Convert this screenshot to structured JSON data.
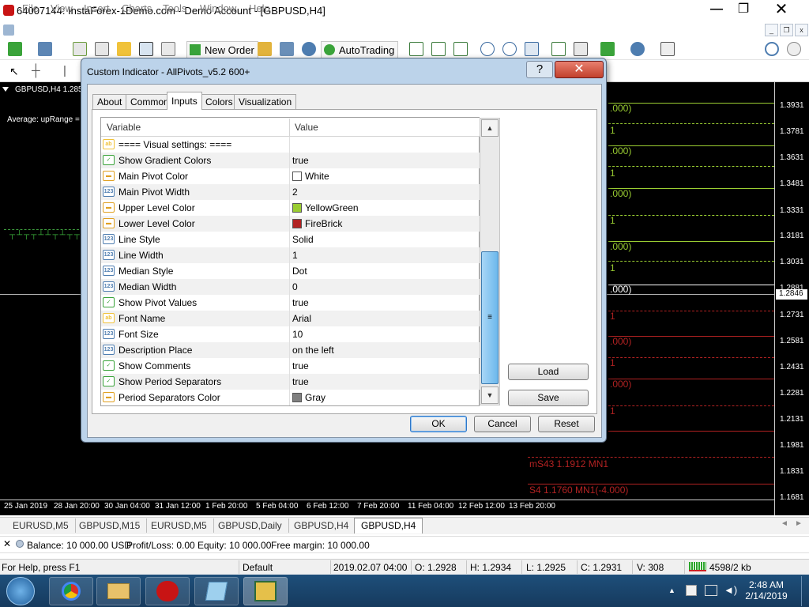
{
  "app": {
    "title": "64007144: InstaForex-1Demo.com - Demo Account - [GBPUSD,H4]",
    "window_controls": [
      "—",
      "❐",
      "✕"
    ]
  },
  "menu": [
    "File",
    "View",
    "Insert",
    "Charts",
    "Tools",
    "Window",
    "Help"
  ],
  "toolbar": {
    "new_order": "New Order",
    "autotrading": "AutoTrading"
  },
  "chart": {
    "header": "GBPUSD,H4  1.285",
    "sub": "Average: upRange =",
    "price_ticks": [
      "1.3931",
      "1.3781",
      "1.3631",
      "1.3481",
      "1.3331",
      "1.3181",
      "1.3031",
      "1.2881",
      "1.2731",
      "1.2581",
      "1.2431",
      "1.2281",
      "1.2131",
      "1.1981",
      "1.1831",
      "1.1681"
    ],
    "current_price": "1.2846",
    "date_ticks": [
      "25 Jan 2019",
      "28 Jan 20:00",
      "30 Jan 04:00",
      "31 Jan 12:00",
      "1 Feb 20:00",
      "5 Feb 04:00",
      "6 Feb 12:00",
      "7 Feb 20:00",
      "11 Feb 04:00",
      "12 Feb 12:00",
      "13 Feb 20:00"
    ],
    "levels": [
      ".000)",
      ".000)",
      ".000)",
      ".000)",
      ".000)",
      ".000)",
      ".000)",
      "mS43 1.1912 MN1",
      "S4 1.1760 MN1(-4.000)"
    ],
    "level_marks": [
      "1",
      "1",
      "1",
      "1",
      "1",
      "1",
      "1"
    ],
    "colors": {
      "green_level": "#9acd32",
      "red_level": "#b22222",
      "white_level": "#ffffff",
      "background": "#000000"
    }
  },
  "chart_tabs": [
    "EURUSD,M5",
    "GBPUSD,M15",
    "EURUSD,M5",
    "GBPUSD,Daily",
    "GBPUSD,H4",
    "GBPUSD,H4"
  ],
  "account": {
    "close_glyph": "✕",
    "balance": "Balance: 10 000.00 USD",
    "profit": "Profit/Loss: 0.00",
    "equity": "Equity: 10 000.00",
    "free_margin": "Free margin: 10 000.00"
  },
  "status": {
    "help": "For Help, press F1",
    "profile": "Default",
    "time": "2019.02.07 04:00",
    "open": "O: 1.2928",
    "high": "H: 1.2934",
    "low": "L: 1.2925",
    "close": "C: 1.2931",
    "volume": "V: 308",
    "traffic": "4598/2 kb"
  },
  "taskbar": {
    "time": "2:48 AM",
    "date": "2/14/2019"
  },
  "dialog": {
    "title": "Custom Indicator - AllPivots_v5.2 600+",
    "help": "?",
    "close": "✕",
    "tabs": [
      "About",
      "Common",
      "Inputs",
      "Colors",
      "Visualization"
    ],
    "active_tab": "Inputs",
    "col_variable": "Variable",
    "col_value": "Value",
    "rows": [
      {
        "icon": "ab",
        "name": "==== Visual settings: ====",
        "value": ""
      },
      {
        "icon": "bool",
        "name": "Show Gradient Colors",
        "value": "true"
      },
      {
        "icon": "color",
        "name": "Main Pivot Color",
        "value": "White",
        "swatch": "#ffffff"
      },
      {
        "icon": "123",
        "name": "Main Pivot Width",
        "value": "2"
      },
      {
        "icon": "color",
        "name": "Upper Level Color",
        "value": "YellowGreen",
        "swatch": "#9acd32"
      },
      {
        "icon": "color",
        "name": "Lower Level Color",
        "value": "FireBrick",
        "swatch": "#b22222"
      },
      {
        "icon": "123",
        "name": "Line Style",
        "value": "Solid"
      },
      {
        "icon": "123",
        "name": "Line Width",
        "value": "1"
      },
      {
        "icon": "123",
        "name": "Median Style",
        "value": "Dot"
      },
      {
        "icon": "123",
        "name": "Median Width",
        "value": "0"
      },
      {
        "icon": "bool",
        "name": "Show Pivot Values",
        "value": "true"
      },
      {
        "icon": "ab",
        "name": "Font Name",
        "value": "Arial"
      },
      {
        "icon": "123",
        "name": "Font Size",
        "value": "10"
      },
      {
        "icon": "123",
        "name": "Description Place",
        "value": "on the left"
      },
      {
        "icon": "bool",
        "name": "Show Comments",
        "value": "true"
      },
      {
        "icon": "bool",
        "name": "Show Period Separators",
        "value": "true"
      },
      {
        "icon": "color",
        "name": "Period Separators Color",
        "value": "Gray",
        "swatch": "#808080"
      }
    ],
    "buttons": {
      "load": "Load",
      "save": "Save",
      "ok": "OK",
      "cancel": "Cancel",
      "reset": "Reset"
    }
  }
}
